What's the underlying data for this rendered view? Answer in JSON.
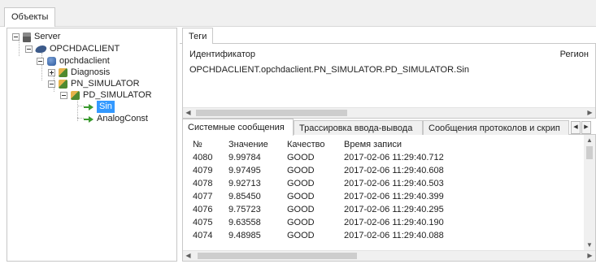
{
  "top_tab": {
    "label": "Объекты"
  },
  "tree": {
    "server": "Server",
    "client": "OPCHDACLIENT",
    "db": "opchdaclient",
    "diagnosis": "Diagnosis",
    "pn_simulator": "PN_SIMULATOR",
    "pd_simulator": "PD_SIMULATOR",
    "sin": "Sin",
    "analog_const": "AnalogConst"
  },
  "tags_panel": {
    "tab": "Теги",
    "col_id": "Идентификатор",
    "col_region": "Регион",
    "rows": [
      "OPCHDACLIENT.opchdaclient.PN_SIMULATOR.PD_SIMULATOR.Sin"
    ]
  },
  "log_panel": {
    "tabs": [
      "Системные сообщения",
      "Трассировка ввода-вывода",
      "Сообщения протоколов и скрип"
    ],
    "columns": [
      "№",
      "Значение",
      "Качество",
      "Время записи"
    ],
    "rows": [
      [
        "4080",
        "9.99784",
        "GOOD",
        "2017-02-06 11:29:40.712"
      ],
      [
        "4079",
        "9.97495",
        "GOOD",
        "2017-02-06 11:29:40.608"
      ],
      [
        "4078",
        "9.92713",
        "GOOD",
        "2017-02-06 11:29:40.503"
      ],
      [
        "4077",
        "9.85450",
        "GOOD",
        "2017-02-06 11:29:40.399"
      ],
      [
        "4076",
        "9.75723",
        "GOOD",
        "2017-02-06 11:29:40.295"
      ],
      [
        "4075",
        "9.63558",
        "GOOD",
        "2017-02-06 11:29:40.190"
      ],
      [
        "4074",
        "9.48985",
        "GOOD",
        "2017-02-06 11:29:40.088"
      ]
    ]
  },
  "colors": {
    "selection": "#3399ff",
    "border": "#c8c8c8",
    "chrome": "#f0f0f0"
  }
}
